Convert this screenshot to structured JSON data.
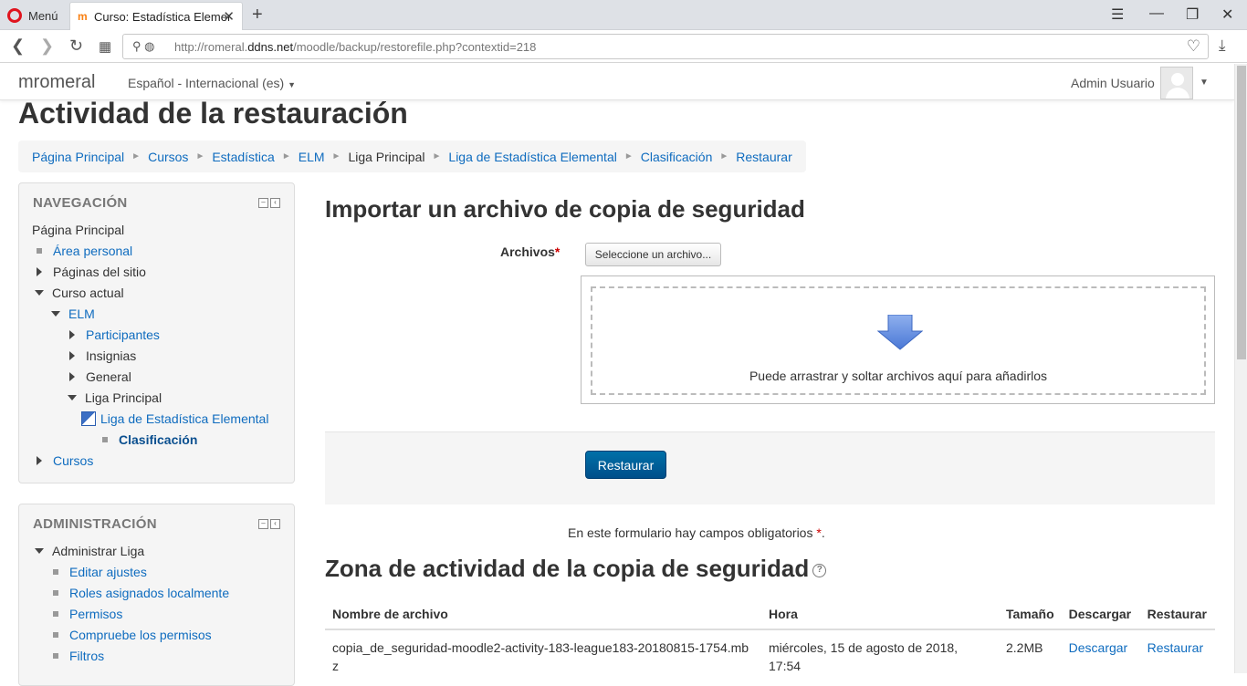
{
  "browser": {
    "menu_label": "Menú",
    "tab_title": "Curso: Estadística Elemental",
    "url_path_prefix": "http://romeral.",
    "url_domain": "ddns.net",
    "url_rest": "/moodle/backup/restorefile.php?contextid=218"
  },
  "moodle_nav": {
    "brand": "mromeral",
    "language": "Español - Internacional (es)",
    "user_name": "Admin Usuario"
  },
  "page": {
    "title": "Actividad de la restauración",
    "breadcrumb": [
      {
        "label": "Página Principal",
        "link": true
      },
      {
        "label": "Cursos",
        "link": true
      },
      {
        "label": "Estadística",
        "link": true
      },
      {
        "label": "ELM",
        "link": true
      },
      {
        "label": "Liga Principal",
        "link": false
      },
      {
        "label": "Liga de Estadística Elemental",
        "link": true
      },
      {
        "label": "Clasificación",
        "link": true
      },
      {
        "label": "Restaurar",
        "link": true
      }
    ]
  },
  "navigation_block": {
    "title": "NAVEGACIÓN",
    "home": "Página Principal",
    "area_personal": "Área personal",
    "paginas_sitio": "Páginas del sitio",
    "curso_actual": "Curso actual",
    "elm": "ELM",
    "participantes": "Participantes",
    "insignias": "Insignias",
    "general": "General",
    "liga_principal": "Liga Principal",
    "liga_estadistica": "Liga de Estadística Elemental",
    "clasificacion": "Clasificación",
    "cursos": "Cursos"
  },
  "admin_block": {
    "title": "ADMINISTRACIÓN",
    "administrar_liga": "Administrar Liga",
    "items": [
      "Editar ajustes",
      "Roles asignados localmente",
      "Permisos",
      "Compruebe los permisos",
      "Filtros"
    ]
  },
  "import": {
    "heading": "Importar un archivo de copia de seguridad",
    "files_label": "Archivos",
    "required_mark": "*",
    "choose_button": "Seleccione un archivo...",
    "drop_text": "Puede arrastrar y soltar archivos aquí para añadirlos",
    "restore_button": "Restaurar",
    "required_note": "En este formulario hay campos obligatorios",
    "required_note_end": "."
  },
  "backup_zone": {
    "heading": "Zona de actividad de la copia de seguridad",
    "columns": [
      "Nombre de archivo",
      "Hora",
      "Tamaño",
      "Descargar",
      "Restaurar"
    ],
    "rows": [
      {
        "filename": "copia_de_seguridad-moodle2-activity-183-league183-20180815-1754.mbz",
        "time": "miércoles, 15 de agosto de 2018, 17:54",
        "size": "2.2MB",
        "download": "Descargar",
        "restore": "Restaurar"
      }
    ]
  },
  "colors": {
    "link": "#0f6cbf",
    "primary_button": "#0062a0",
    "required": "#cc0000"
  }
}
